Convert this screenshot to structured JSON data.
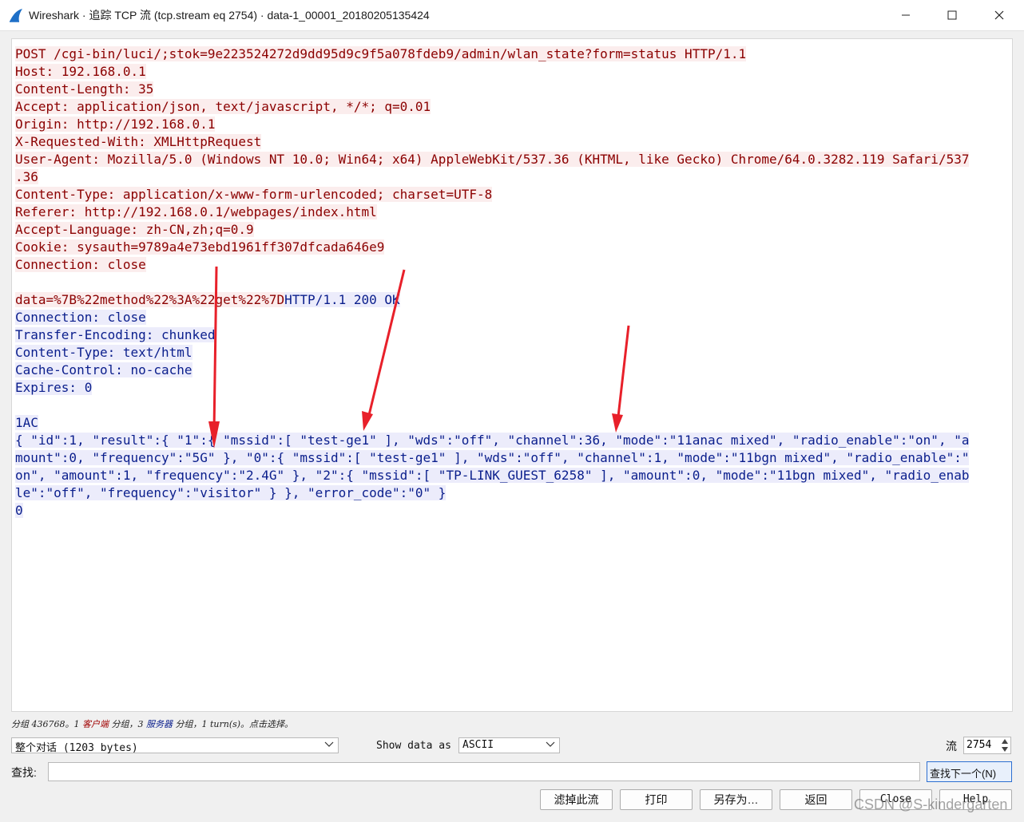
{
  "window": {
    "title": "Wireshark · 追踪 TCP 流 (tcp.stream eq 2754) · data-1_00001_20180205135424",
    "icon": "wireshark-fin-icon"
  },
  "colors": {
    "client_text": "#8b0000",
    "client_bg": "#fbeded",
    "server_text": "#0a1e8c",
    "server_bg": "#ececfb",
    "arrow": "#e8202a"
  },
  "stream_lines": [
    [
      {
        "t": "POST /cgi-bin/luci/;stok=9e223524272d9dd95d9c9f5a078fdeb9/admin/wlan_state?form=status HTTP/1.1",
        "s": "c"
      }
    ],
    [
      {
        "t": "Host: 192.168.0.1",
        "s": "c"
      }
    ],
    [
      {
        "t": "Content-Length: 35",
        "s": "c"
      }
    ],
    [
      {
        "t": "Accept: application/json, text/javascript, */*; q=0.01",
        "s": "c"
      }
    ],
    [
      {
        "t": "Origin: http://192.168.0.1",
        "s": "c"
      }
    ],
    [
      {
        "t": "X-Requested-With: XMLHttpRequest",
        "s": "c"
      }
    ],
    [
      {
        "t": "User-Agent: Mozilla/5.0 (Windows NT 10.0; Win64; x64) AppleWebKit/537.36 (KHTML, like Gecko) Chrome/64.0.3282.119 Safari/537",
        "s": "c"
      }
    ],
    [
      {
        "t": ".36",
        "s": "c"
      }
    ],
    [
      {
        "t": "Content-Type: application/x-www-form-urlencoded; charset=UTF-8",
        "s": "c"
      }
    ],
    [
      {
        "t": "Referer: http://192.168.0.1/webpages/index.html",
        "s": "c"
      }
    ],
    [
      {
        "t": "Accept-Language: zh-CN,zh;q=0.9",
        "s": "c"
      }
    ],
    [
      {
        "t": "Cookie: sysauth=9789a4e73ebd1961ff307dfcada646e9",
        "s": "c"
      }
    ],
    [
      {
        "t": "Connection: close",
        "s": "c"
      }
    ],
    [],
    [
      {
        "t": "data=%7B%22method%22%3A%22get%22%7D",
        "s": "c"
      },
      {
        "t": "HTTP/1.1 200 OK",
        "s": "s"
      }
    ],
    [
      {
        "t": "Connection: close",
        "s": "s"
      }
    ],
    [
      {
        "t": "Transfer-Encoding: chunked",
        "s": "s"
      }
    ],
    [
      {
        "t": "Content-Type: text/html",
        "s": "s"
      }
    ],
    [
      {
        "t": "Cache-Control: no-cache",
        "s": "s"
      }
    ],
    [
      {
        "t": "Expires: 0",
        "s": "s"
      }
    ],
    [],
    [
      {
        "t": "1AC",
        "s": "s"
      }
    ],
    [
      {
        "t": "{ \"id\":1, \"result\":{ \"1\":{ \"mssid\":[ \"test-ge1\" ], \"wds\":\"off\", \"channel\":36, \"mode\":\"11anac mixed\", \"radio_enable\":\"on\", \"a",
        "s": "s"
      }
    ],
    [
      {
        "t": "mount\":0, \"frequency\":\"5G\" }, \"0\":{ \"mssid\":[ \"test-ge1\" ], \"wds\":\"off\", \"channel\":1, \"mode\":\"11bgn mixed\", \"radio_enable\":\"",
        "s": "s"
      }
    ],
    [
      {
        "t": "on\", \"amount\":1, \"frequency\":\"2.4G\" }, \"2\":{ \"mssid\":[ \"TP-LINK_GUEST_6258\" ], \"amount\":0, \"mode\":\"11bgn mixed\", \"radio_enab",
        "s": "s"
      }
    ],
    [
      {
        "t": "le\":\"off\", \"frequency\":\"visitor\" } }, \"error_code\":\"0\" }",
        "s": "s"
      }
    ],
    [
      {
        "t": "0",
        "s": "s"
      }
    ]
  ],
  "status": {
    "p1": "分组 436768。1 ",
    "client": "客户端",
    "p2": " 分组，3 ",
    "server": "服务器",
    "p3": " 分组，1 turn(s)。点击选择。"
  },
  "controls": {
    "conversation_select": "整个对话 (1203 bytes)",
    "show_data_label": "Show data as",
    "show_as_select": "ASCII",
    "stream_label": "流",
    "stream_value": "2754",
    "find_label": "查找:",
    "find_value": "",
    "find_next": "查找下一个(N)"
  },
  "buttons": {
    "filter_out": "滤掉此流",
    "print": "打印",
    "save_as": "另存为…",
    "back": "返回",
    "close": "Close",
    "help": "Help"
  },
  "watermark": "CSDN @S-kindergarten"
}
